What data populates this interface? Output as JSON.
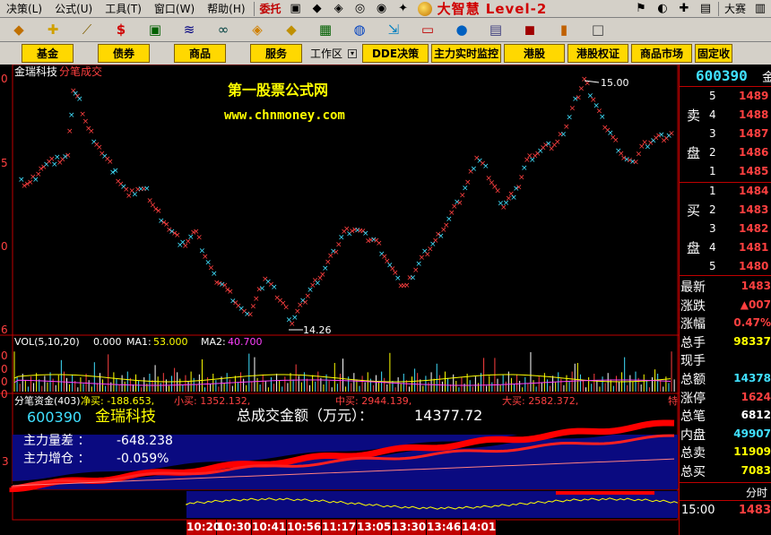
{
  "menu": {
    "items": [
      "决策(L)",
      "公式(U)",
      "工具(T)",
      "窗口(W)",
      "帮助(H)"
    ],
    "weituo": "委托",
    "brand": "大智慧 Level-2",
    "dasai": "大赛"
  },
  "func_buttons": [
    "基金",
    "债券",
    "商品",
    "服务"
  ],
  "workarea": "工作区",
  "func_buttons2": [
    "DDE决策",
    "主力实时监控",
    "港股",
    "港股权证",
    "商品市场",
    "固定收"
  ],
  "chart": {
    "stock_name": "金瑞科技",
    "mode": "分笔成交",
    "watermark1": "第一股票公式网",
    "watermark2": "www.chnmoney.com",
    "high_label": "15.00",
    "low_label": "14.26",
    "y_ticks": [
      "0",
      "5",
      "0",
      "6"
    ],
    "vol_label": "VOL(5,10,20)",
    "vol_value": "0.000",
    "ma1_label": "MA1:",
    "ma1_value": "53.000",
    "ma2_label": "MA2:",
    "ma2_value": "40.700",
    "vol_y_ticks": [
      "0",
      "0",
      "0",
      "0"
    ],
    "fund_title": "分笔资金(403)",
    "net_buy": "净买: -188.653,",
    "small_buy": "小买: 1352.132,",
    "mid_buy": "中买: 2944.139,",
    "large_buy": "大买: 2582.372,",
    "tail_text": "特",
    "code": "600390",
    "name": "金瑞科技",
    "total_label": "总成交金额（万元）：",
    "total_value": "14377.72",
    "main_diff_label": "主力量差 ：",
    "main_diff_value": "-648.238",
    "main_pos_label": "主力增仓 ：",
    "main_pos_value": "-0.059%",
    "fund_y_tick": "3",
    "time_axis": [
      "10:20",
      "10:30",
      "10:41",
      "10:56",
      "11:17",
      "13:05",
      "13:30",
      "13:46",
      "14:01"
    ]
  },
  "right": {
    "code": "600390",
    "code_tail": "金",
    "sell_label_1": "卖",
    "sell_label_2": "盘",
    "buy_label_1": "买",
    "buy_label_2": "盘",
    "sell_levels": [
      {
        "lvl": "5",
        "price": "1489"
      },
      {
        "lvl": "4",
        "price": "1488"
      },
      {
        "lvl": "3",
        "price": "1487"
      },
      {
        "lvl": "2",
        "price": "1486"
      },
      {
        "lvl": "1",
        "price": "1485"
      }
    ],
    "buy_levels": [
      {
        "lvl": "1",
        "price": "1484"
      },
      {
        "lvl": "2",
        "price": "1483"
      },
      {
        "lvl": "3",
        "price": "1482"
      },
      {
        "lvl": "4",
        "price": "1481"
      },
      {
        "lvl": "5",
        "price": "1480"
      }
    ],
    "stats": [
      {
        "label": "最新",
        "value": "1483",
        "color": "#ff4040"
      },
      {
        "label": "涨跌",
        "value": "▲007",
        "color": "#ff4040"
      },
      {
        "label": "涨幅",
        "value": "0.47%",
        "color": "#ff4040"
      },
      {
        "label": "总手",
        "value": "98337",
        "color": "#ffff00"
      },
      {
        "label": "现手",
        "value": "",
        "color": "#ffff00"
      },
      {
        "label": "总额",
        "value": "14378",
        "color": "#40e0ff"
      },
      {
        "label": "涨停",
        "value": "1624",
        "color": "#ff4040"
      },
      {
        "label": "总笔",
        "value": "6812",
        "color": "#ffffff"
      },
      {
        "label": "内盘",
        "value": "49907",
        "color": "#40e0ff"
      },
      {
        "label": "总卖",
        "value": "11909",
        "color": "#ffff00"
      },
      {
        "label": "总买",
        "value": "7083",
        "color": "#ffff00"
      }
    ],
    "fenshi": "分时",
    "last_time": "15:00",
    "last_price": "1483"
  },
  "colors": {
    "up": "#ff4040",
    "down": "#40e0ff",
    "grid": "#c00000",
    "volume_yellow": "#ffff00",
    "fund_band": "#0a0a80"
  }
}
